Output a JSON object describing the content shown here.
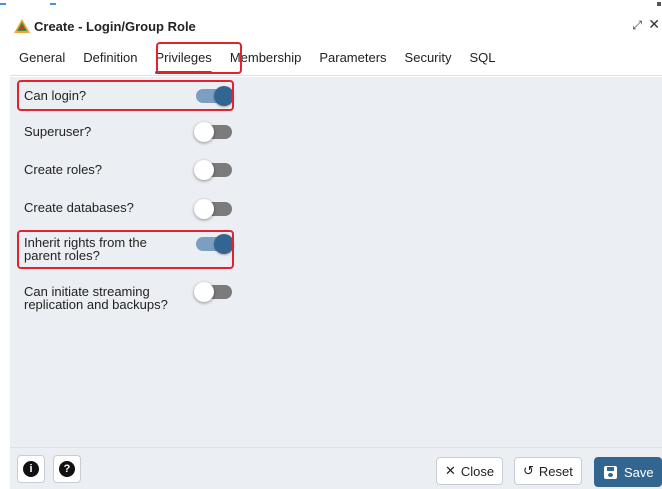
{
  "dialog": {
    "title": "Create - Login/Group Role",
    "app_icon": "pgadmin-logo-icon",
    "expand_icon": "expand-icon",
    "close_icon": "close-icon",
    "expand_glyph": "⤢",
    "close_glyph": "✕"
  },
  "tabs": [
    {
      "label": "General",
      "active": false
    },
    {
      "label": "Definition",
      "active": false
    },
    {
      "label": "Privileges",
      "active": true
    },
    {
      "label": "Membership",
      "active": false
    },
    {
      "label": "Parameters",
      "active": false
    },
    {
      "label": "Security",
      "active": false
    },
    {
      "label": "SQL",
      "active": false
    }
  ],
  "privileges": [
    {
      "label": "Can login?",
      "enabled": true,
      "highlighted": true
    },
    {
      "label": "Superuser?",
      "enabled": false,
      "highlighted": false
    },
    {
      "label": "Create roles?",
      "enabled": false,
      "highlighted": false
    },
    {
      "label": "Create databases?",
      "enabled": false,
      "highlighted": false
    },
    {
      "label": "Inherit rights from the parent roles?",
      "enabled": true,
      "highlighted": true
    },
    {
      "label": "Can initiate streaming replication and backups?",
      "enabled": false,
      "highlighted": false
    }
  ],
  "footer": {
    "info_icon": "info-icon",
    "info_glyph": "i",
    "help_icon": "help-icon",
    "help_glyph": "?",
    "close_label": "Close",
    "close_glyph": "✕",
    "reset_label": "Reset",
    "reset_glyph": "↺",
    "save_label": "Save"
  },
  "colors": {
    "accent": "#326690",
    "highlight": "#e0232e",
    "panel_bg": "#ebeef3"
  }
}
